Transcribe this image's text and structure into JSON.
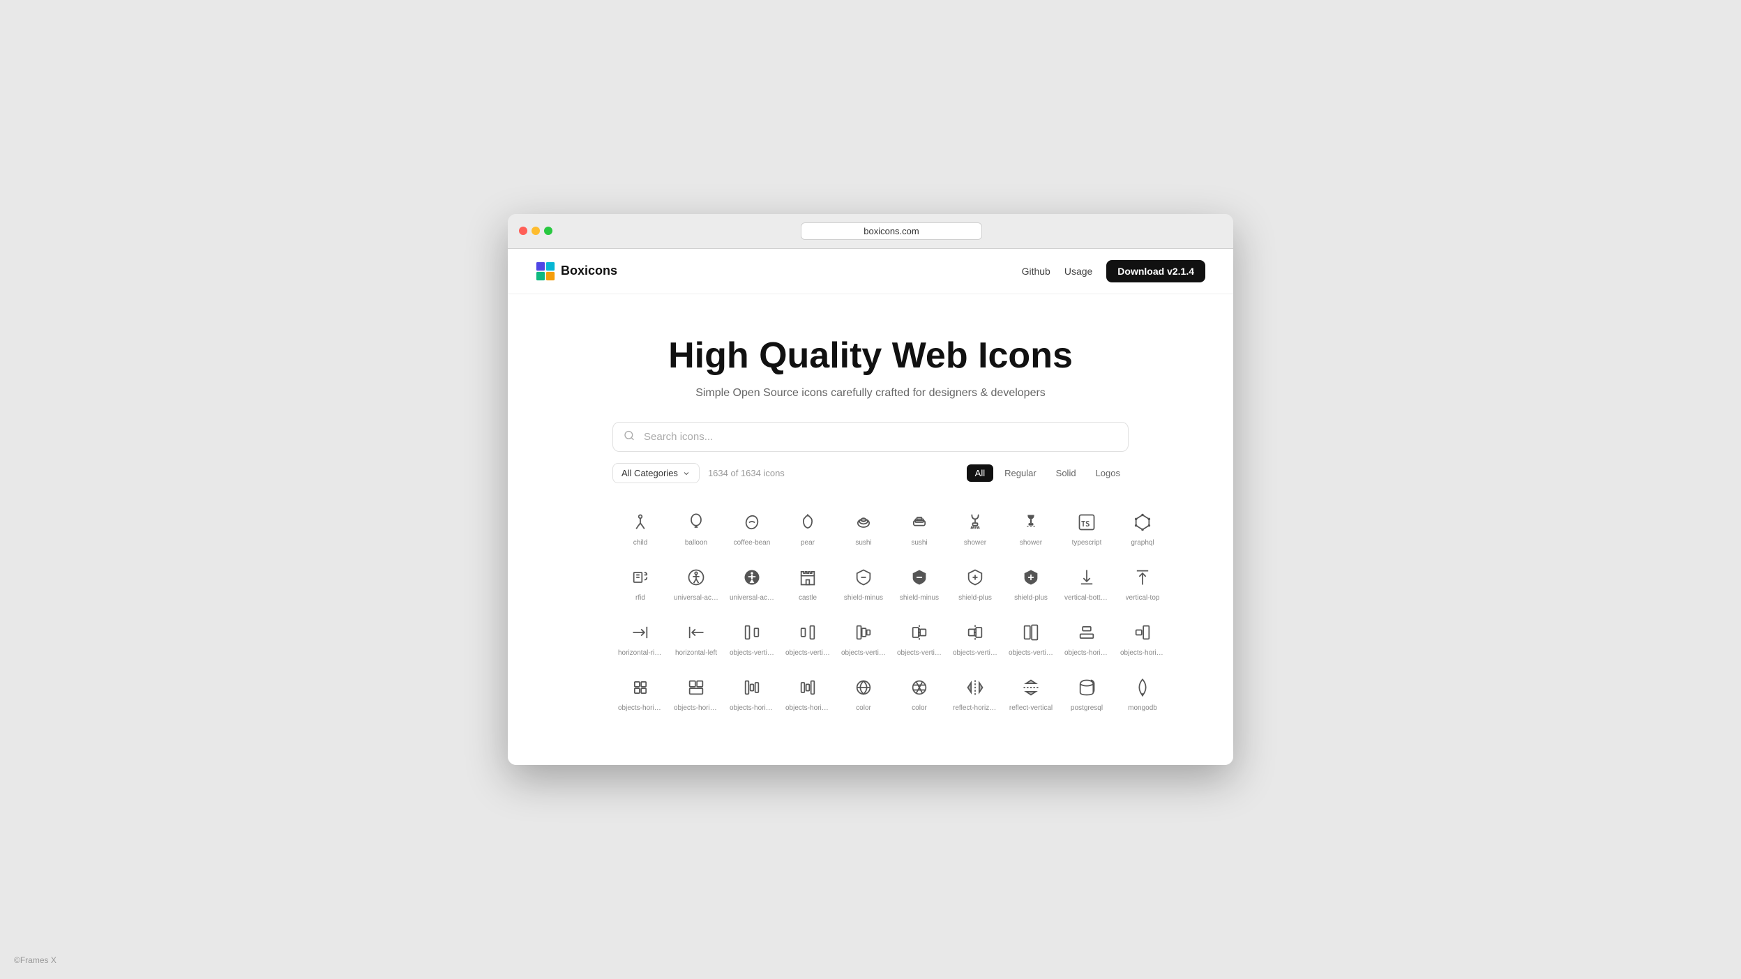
{
  "browser": {
    "url": "boxicons.com"
  },
  "navbar": {
    "logo_text": "Boxicons",
    "github_label": "Github",
    "usage_label": "Usage",
    "download_label": "Download v2.1.4"
  },
  "hero": {
    "title": "High Quality Web Icons",
    "subtitle": "Simple Open Source icons carefully crafted for designers & developers",
    "search_placeholder": "Search icons..."
  },
  "filters": {
    "category_label": "All Categories",
    "icon_count": "1634 of 1634 icons",
    "types": [
      "All",
      "Regular",
      "Solid",
      "Logos"
    ]
  },
  "icon_rows": [
    [
      {
        "name": "child",
        "label": "child"
      },
      {
        "name": "balloon",
        "label": "balloon"
      },
      {
        "name": "coffee-bean",
        "label": "coffee-bean"
      },
      {
        "name": "pear",
        "label": "pear"
      },
      {
        "name": "sushi",
        "label": "sushi"
      },
      {
        "name": "sushi2",
        "label": "sushi"
      },
      {
        "name": "shower",
        "label": "shower"
      },
      {
        "name": "shower2",
        "label": "shower"
      },
      {
        "name": "typescript",
        "label": "typescript"
      },
      {
        "name": "graphql",
        "label": "graphql"
      }
    ],
    [
      {
        "name": "rfid",
        "label": "rfid"
      },
      {
        "name": "universal-access",
        "label": "universal-ace..."
      },
      {
        "name": "universal-access2",
        "label": "universal-ace..."
      },
      {
        "name": "castle",
        "label": "castle"
      },
      {
        "name": "shield-minus",
        "label": "shield-minus"
      },
      {
        "name": "shield-minus2",
        "label": "shield-minus"
      },
      {
        "name": "shield-plus",
        "label": "shield-plus"
      },
      {
        "name": "shield-plus2",
        "label": "shield-plus"
      },
      {
        "name": "vertical-bottom",
        "label": "vertical-bottom"
      },
      {
        "name": "vertical-top",
        "label": "vertical-top"
      }
    ],
    [
      {
        "name": "horizontal-right",
        "label": "horizontal-right"
      },
      {
        "name": "horizontal-left",
        "label": "horizontal-left"
      },
      {
        "name": "objects-vertic1",
        "label": "objects-vertic..."
      },
      {
        "name": "objects-vertic2",
        "label": "objects-vertic..."
      },
      {
        "name": "objects-vertic3",
        "label": "objects-vertic..."
      },
      {
        "name": "objects-vertic4",
        "label": "objects-vertic..."
      },
      {
        "name": "objects-vertic5",
        "label": "objects-vertic..."
      },
      {
        "name": "objects-vertic6",
        "label": "objects-vertic..."
      },
      {
        "name": "objects-horiz1",
        "label": "objects-horizo..."
      },
      {
        "name": "objects-horiz2",
        "label": "objects-horizo..."
      }
    ],
    [
      {
        "name": "objects-horiz3",
        "label": "objects-horizo..."
      },
      {
        "name": "objects-horiz4",
        "label": "objects-horizo..."
      },
      {
        "name": "objects-horiz5",
        "label": "objects-horizo..."
      },
      {
        "name": "objects-horiz6",
        "label": "objects-horizo..."
      },
      {
        "name": "color1",
        "label": "color"
      },
      {
        "name": "color2",
        "label": "color"
      },
      {
        "name": "reflect-horiz",
        "label": "reflect-horizo..."
      },
      {
        "name": "reflect-vertical",
        "label": "reflect-vertical"
      },
      {
        "name": "postgresql",
        "label": "postgresql"
      },
      {
        "name": "mongodb",
        "label": "mongodb"
      }
    ]
  ],
  "footer": {
    "credit": "©Frames X"
  }
}
